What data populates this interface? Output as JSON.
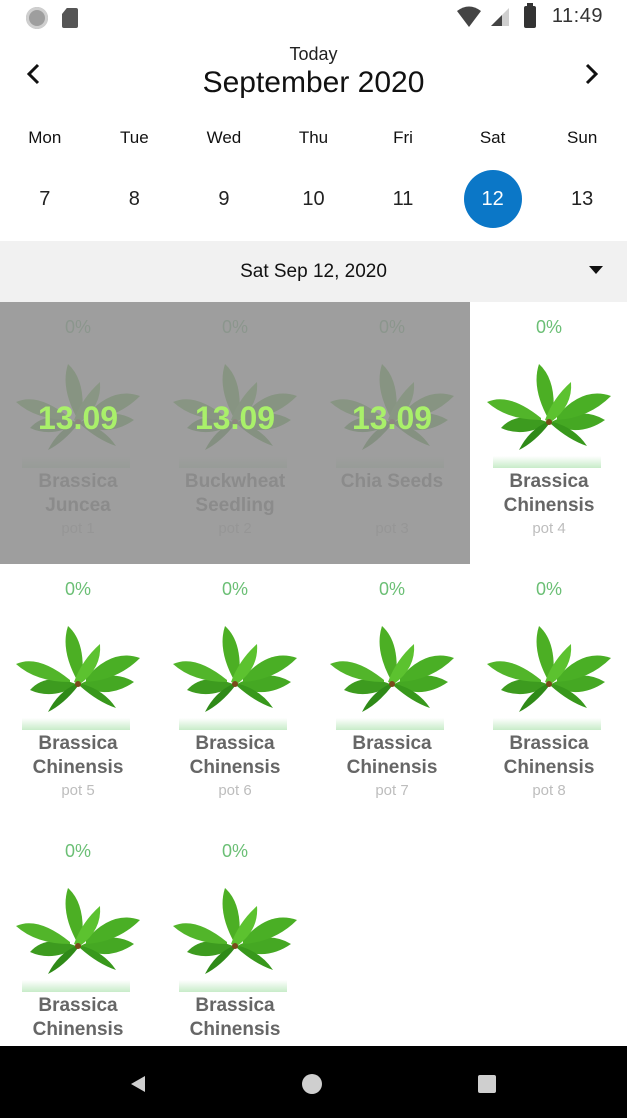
{
  "status_bar": {
    "time": "11:49"
  },
  "header": {
    "today_label": "Today",
    "month_title": "September 2020"
  },
  "weekdays": [
    "Mon",
    "Tue",
    "Wed",
    "Thu",
    "Fri",
    "Sat",
    "Sun"
  ],
  "days": [
    "7",
    "8",
    "9",
    "10",
    "11",
    "12",
    "13"
  ],
  "selected_day": "12",
  "date_bar": {
    "text": "Sat Sep 12, 2020"
  },
  "colors": {
    "accent": "#0b77c7",
    "percent": "#6bbf75",
    "overlay_number": "#a9f06a"
  },
  "pots": [
    {
      "percent": "0%",
      "name_line1": "Brassica",
      "name_line2": "Juncea",
      "pot_label": "pot 1",
      "overlay": "13.09"
    },
    {
      "percent": "0%",
      "name_line1": "Buckwheat",
      "name_line2": "Seedling",
      "pot_label": "pot 2",
      "overlay": "13.09"
    },
    {
      "percent": "0%",
      "name_line1": "Chia Seeds",
      "name_line2": "",
      "pot_label": "pot 3",
      "overlay": "13.09"
    },
    {
      "percent": "0%",
      "name_line1": "Brassica",
      "name_line2": "Chinensis",
      "pot_label": "pot 4"
    },
    {
      "percent": "0%",
      "name_line1": "Brassica",
      "name_line2": "Chinensis",
      "pot_label": "pot 5"
    },
    {
      "percent": "0%",
      "name_line1": "Brassica",
      "name_line2": "Chinensis",
      "pot_label": "pot 6"
    },
    {
      "percent": "0%",
      "name_line1": "Brassica",
      "name_line2": "Chinensis",
      "pot_label": "pot 7"
    },
    {
      "percent": "0%",
      "name_line1": "Brassica",
      "name_line2": "Chinensis",
      "pot_label": "pot 8"
    },
    {
      "percent": "0%",
      "name_line1": "Brassica",
      "name_line2": "Chinensis",
      "pot_label": ""
    },
    {
      "percent": "0%",
      "name_line1": "Brassica",
      "name_line2": "Chinensis",
      "pot_label": ""
    }
  ]
}
